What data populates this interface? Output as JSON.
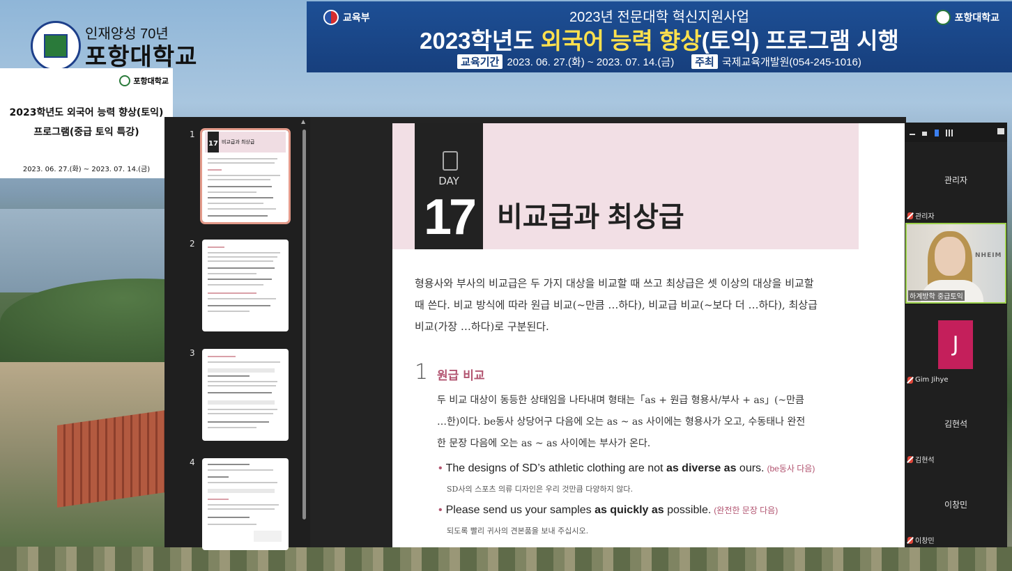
{
  "logo": {
    "sub": "인재양성 70년",
    "name": "포항대학교"
  },
  "banner": {
    "ministry": "교육부",
    "univ": "포항대학교",
    "line1": "2023년 전문대학 혁신지원사업",
    "line2_a": "2023학년도 ",
    "line2_hl1": "외국어 능력 향상",
    "line2_b": "(토익) 프로그램 시행",
    "period_tag": "교육기간",
    "period": "2023. 06. 27.(화) ~ 2023. 07. 14.(금)",
    "host_tag": "주최",
    "host": "국제교육개발원(054-245-1016)"
  },
  "info_card": {
    "univ": "포항대학교",
    "title_line1": "2023학년도 외국어 능력 향상(토익)",
    "title_line2": "프로그램(중급 토익 특강)",
    "period": "2023. 06. 27.(화) ~ 2023. 07. 14.(금)"
  },
  "thumbnails": [
    {
      "num": "1",
      "day": "17",
      "title": "비교급과 최상급",
      "selected": true
    },
    {
      "num": "2",
      "selected": false
    },
    {
      "num": "3",
      "selected": false
    },
    {
      "num": "4",
      "selected": false
    }
  ],
  "page": {
    "day_label": "DAY",
    "day_num": "17",
    "title": "비교급과 최상급",
    "intro": "형용사와 부사의 비교급은 두 가지 대상을 비교할 때 쓰고 최상급은 셋 이상의 대상을 비교할 때 쓴다. 비교 방식에 따라 원급 비교(~만큼 …하다), 비교급 비교(~보다 더 …하다), 최상급 비교(가장 …하다)로 구분된다.",
    "section_num": "1",
    "section_title": "원급 비교",
    "section_body": "두 비교 대상이 동등한 상태임을 나타내며 형태는「as + 원급 형용사/부사 + as」(~만큼 …한)이다. be동사 상당어구 다음에 오는 as ~ as 사이에는 형용사가 오고, 수동태나 완전한 문장 다음에 오는 as ~ as 사이에는 부사가 온다.",
    "ex1_pre": "The designs of SD’s athletic clothing are not ",
    "ex1_bold": "as diverse as",
    "ex1_post": " ours.",
    "ex1_note": "(be동사 다음)",
    "ex1_tr": "SD사의 스포츠 의류 디자인은 우리 것만큼 다양하지 않다.",
    "ex2_pre": "Please send us your samples ",
    "ex2_bold": "as quickly as",
    "ex2_post": " possible.",
    "ex2_note": "(완전한 문장 다음)",
    "ex2_tr": "되도록 빨리 귀사의 견본품을 보내 주십시오."
  },
  "participants": [
    {
      "name": "관리자",
      "label": "관리자"
    },
    {
      "label": "하계방학 중급토익",
      "video_sign": "NHEIM"
    },
    {
      "avatar": "J",
      "label": "Gim Jihye"
    },
    {
      "name": "김현석",
      "label": "김현석"
    },
    {
      "name": "이창민",
      "label": "이창민"
    }
  ],
  "colors": {
    "banner_bg": "#1d4f95",
    "highlight": "#ffe14d",
    "accent": "#b25470",
    "header_band": "#f2dfe5",
    "avatar": "#c41f5b",
    "active_speaker": "#9bd04b"
  }
}
